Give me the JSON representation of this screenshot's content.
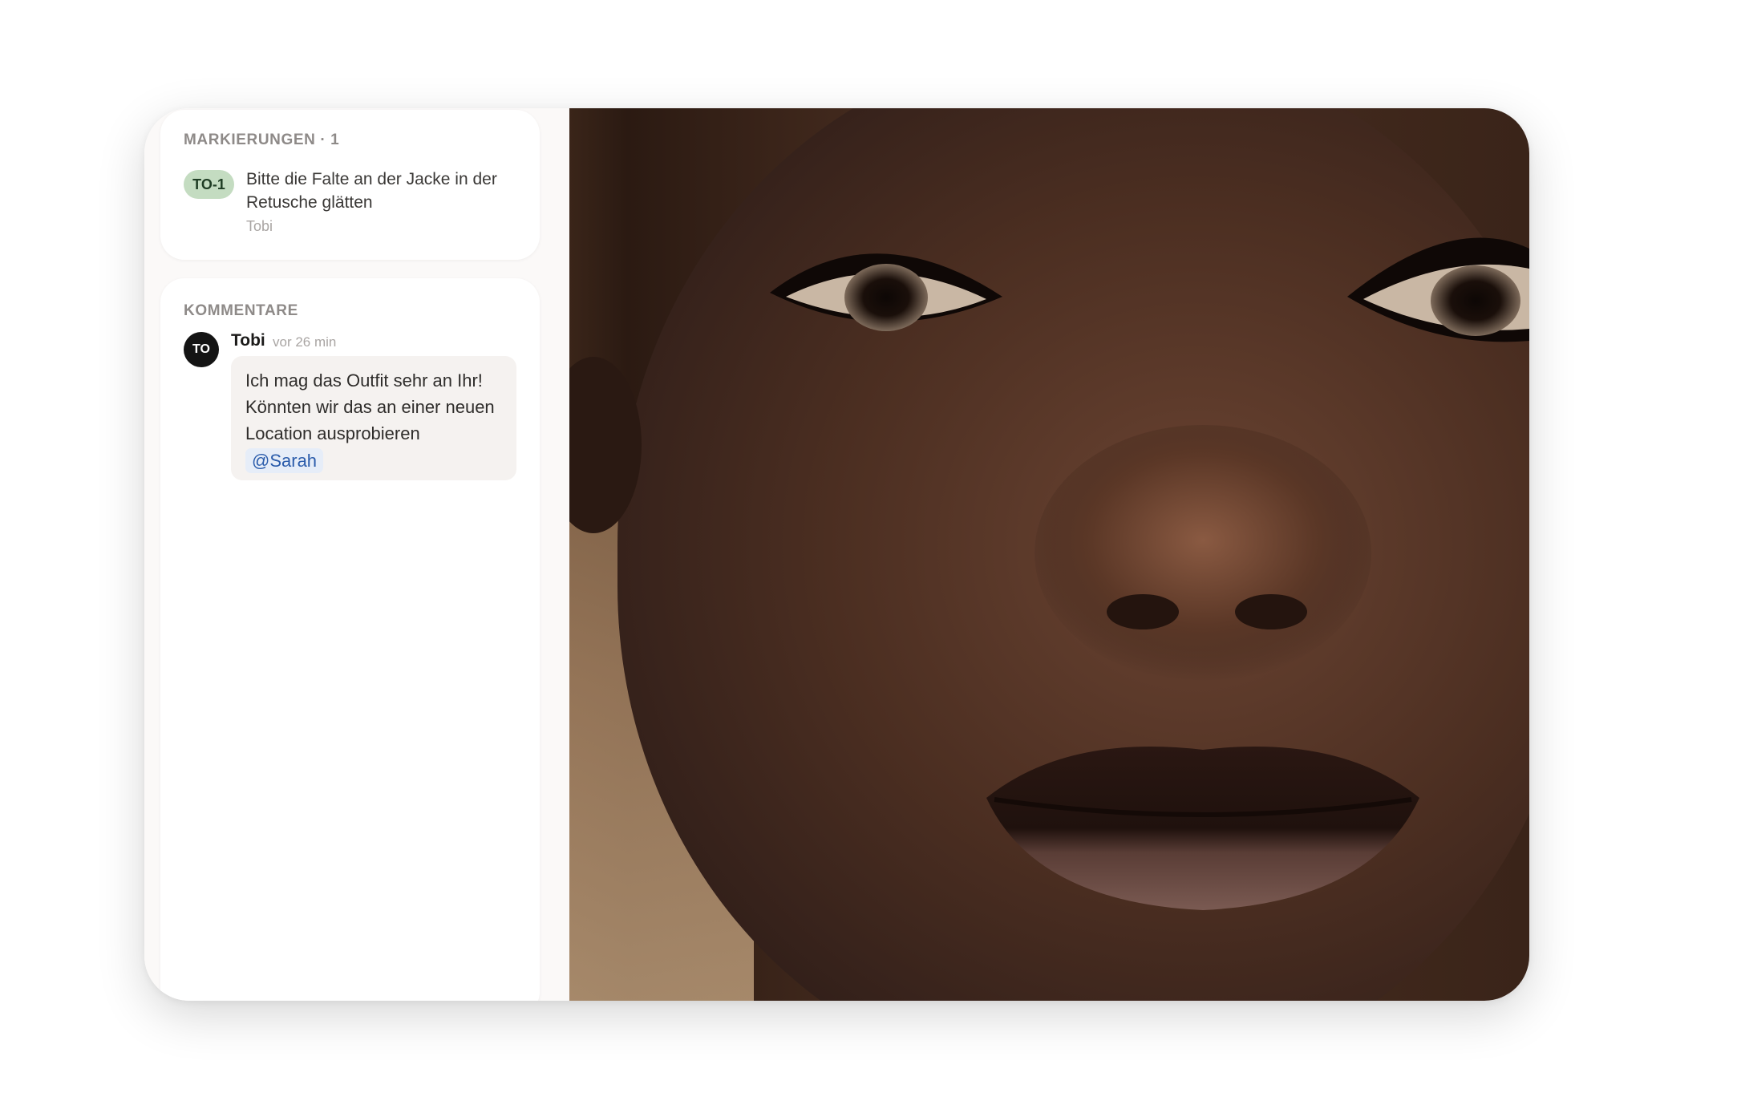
{
  "markings": {
    "title": "MARKIERUNGEN · 1",
    "items": [
      {
        "tag": "TO-1",
        "text": "Bitte die Falte an der Jacke in der Retusche glätten",
        "author": "Tobi"
      }
    ]
  },
  "comments": {
    "title": "KOMMENTARE",
    "items": [
      {
        "avatar_initials": "TO",
        "author": "Tobi",
        "time": "vor 26 min",
        "text": "Ich mag das Outfit sehr an Ihr! Könnten wir das an einer neuen Location ausprobieren",
        "mention": "@Sarah"
      }
    ]
  },
  "colors": {
    "tag_bg": "#c4dcc1",
    "mention_text": "#2b5cab",
    "avatar_bg": "#141414",
    "bubble_bg": "#f5f2f0"
  }
}
